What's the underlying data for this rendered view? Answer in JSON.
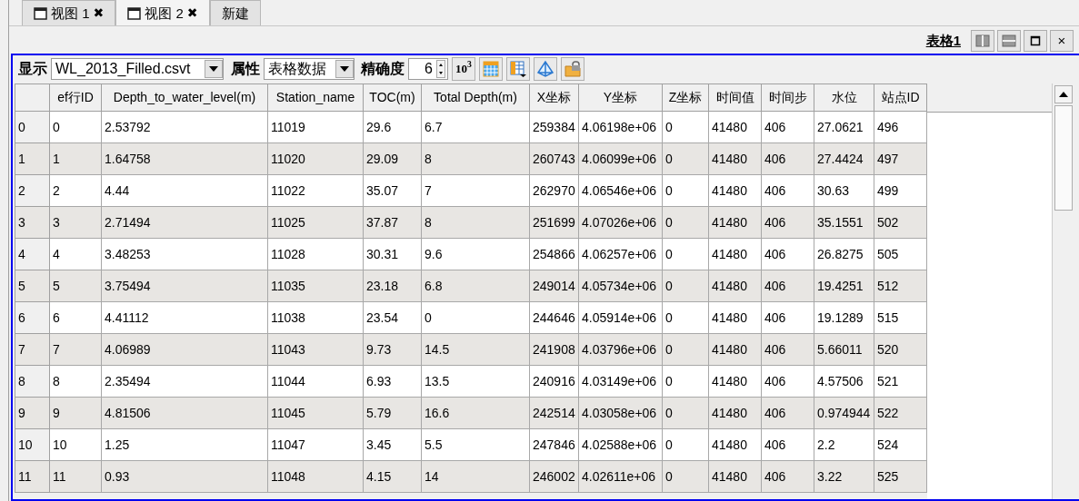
{
  "tabs": [
    {
      "label": "视图 1",
      "close": "✖",
      "selected": false
    },
    {
      "label": "视图 2",
      "close": "✖",
      "selected": true
    },
    {
      "label": "新建",
      "selected": false
    }
  ],
  "panel": {
    "title": "表格1",
    "close": "×"
  },
  "toolbar": {
    "display_label": "显示",
    "display_value": "WL_2013_Filled.csvt",
    "attribute_label": "属性",
    "attribute_value": "表格数据",
    "precision_label": "精确度",
    "precision_value": "6",
    "exponent_button": "10$^{3}$"
  },
  "table": {
    "columns": [
      "ef行ID",
      "Depth_to_water_level(m)",
      "Station_name",
      "TOC(m)",
      "Total Depth(m)",
      "X坐标",
      "Y坐标",
      "Z坐标",
      "时间值",
      "时间步",
      "水位",
      "站点ID"
    ],
    "rows": [
      {
        "header": "0",
        "cells": [
          "0",
          "2.53792",
          "11019",
          "29.6",
          "6.7",
          "259384",
          "4.06198e+06",
          "0",
          "41480",
          "406",
          "27.0621",
          "496"
        ]
      },
      {
        "header": "1",
        "cells": [
          "1",
          "1.64758",
          "11020",
          "29.09",
          "8",
          "260743",
          "4.06099e+06",
          "0",
          "41480",
          "406",
          "27.4424",
          "497"
        ]
      },
      {
        "header": "2",
        "cells": [
          "2",
          "4.44",
          "11022",
          "35.07",
          "7",
          "262970",
          "4.06546e+06",
          "0",
          "41480",
          "406",
          "30.63",
          "499"
        ]
      },
      {
        "header": "3",
        "cells": [
          "3",
          "2.71494",
          "11025",
          "37.87",
          "8",
          "251699",
          "4.07026e+06",
          "0",
          "41480",
          "406",
          "35.1551",
          "502"
        ]
      },
      {
        "header": "4",
        "cells": [
          "4",
          "3.48253",
          "11028",
          "30.31",
          "9.6",
          "254866",
          "4.06257e+06",
          "0",
          "41480",
          "406",
          "26.8275",
          "505"
        ]
      },
      {
        "header": "5",
        "cells": [
          "5",
          "3.75494",
          "11035",
          "23.18",
          "6.8",
          "249014",
          "4.05734e+06",
          "0",
          "41480",
          "406",
          "19.4251",
          "512"
        ]
      },
      {
        "header": "6",
        "cells": [
          "6",
          "4.41112",
          "11038",
          "23.54",
          "0",
          "244646",
          "4.05914e+06",
          "0",
          "41480",
          "406",
          "19.1289",
          "515"
        ]
      },
      {
        "header": "7",
        "cells": [
          "7",
          "4.06989",
          "11043",
          "9.73",
          "14.5",
          "241908",
          "4.03796e+06",
          "0",
          "41480",
          "406",
          "5.66011",
          "520"
        ]
      },
      {
        "header": "8",
        "cells": [
          "8",
          "2.35494",
          "11044",
          "6.93",
          "13.5",
          "240916",
          "4.03149e+06",
          "0",
          "41480",
          "406",
          "4.57506",
          "521"
        ]
      },
      {
        "header": "9",
        "cells": [
          "9",
          "4.81506",
          "11045",
          "5.79",
          "16.6",
          "242514",
          "4.03058e+06",
          "0",
          "41480",
          "406",
          "0.974944",
          "522"
        ]
      },
      {
        "header": "10",
        "cells": [
          "10",
          "1.25",
          "11047",
          "3.45",
          "5.5",
          "247846",
          "4.02588e+06",
          "0",
          "41480",
          "406",
          "2.2",
          "524"
        ]
      },
      {
        "header": "11",
        "cells": [
          "11",
          "0.93",
          "11048",
          "4.15",
          "14",
          "246002",
          "4.02611e+06",
          "0",
          "41480",
          "406",
          "3.22",
          "525"
        ]
      }
    ]
  }
}
